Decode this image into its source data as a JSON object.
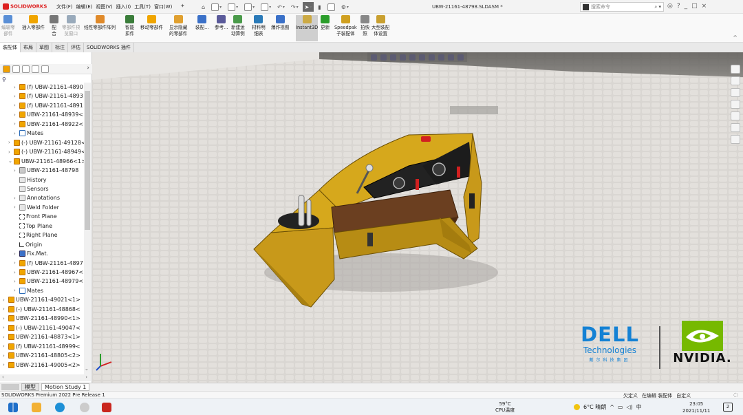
{
  "app": {
    "logo": "SOLIDWORKS",
    "menus": [
      "文件(F)",
      "编辑(E)",
      "视图(V)",
      "插入(I)",
      "工具(T)",
      "窗口(W)"
    ],
    "filename": "UBW-21161-48798.SLDASM *",
    "search_placeholder": "搜索命令",
    "window_controls": [
      "?",
      "_",
      "□",
      "×"
    ]
  },
  "ribbon": {
    "commands": [
      {
        "l1": "编辑零",
        "l2": "部件",
        "dim": true
      },
      {
        "l1": "插入零部件",
        "l2": "",
        "dim": false
      },
      {
        "l1": "配",
        "l2": "合",
        "dim": false
      },
      {
        "l1": "零部件预",
        "l2": "览窗口",
        "dim": true
      },
      {
        "l1": "线性零部件阵列",
        "l2": "",
        "dim": false
      },
      {
        "l1": "智能",
        "l2": "扣件",
        "dim": false
      },
      {
        "l1": "移动零部件",
        "l2": "",
        "dim": false
      },
      {
        "l1": "显示隐藏",
        "l2": "的零部件",
        "dim": false
      },
      {
        "l1": "装配...",
        "l2": "",
        "dim": false
      },
      {
        "l1": "参考...",
        "l2": "",
        "dim": false
      },
      {
        "l1": "新建运",
        "l2": "动算例",
        "dim": false
      },
      {
        "l1": "材料明",
        "l2": "细表",
        "dim": false
      },
      {
        "l1": "爆炸视图",
        "l2": "",
        "dim": false
      },
      {
        "l1": "Instant3D",
        "l2": "",
        "dim": false
      },
      {
        "l1": "更新",
        "l2": "",
        "dim": false
      },
      {
        "l1": "Speedpak",
        "l2": "子装配体",
        "dim": false
      },
      {
        "l1": "拍快",
        "l2": "照",
        "dim": false
      },
      {
        "l1": "大型装配",
        "l2": "体设置",
        "dim": false
      }
    ]
  },
  "tabs": [
    "装配体",
    "布局",
    "草图",
    "标注",
    "评估",
    "SOLIDWORKS 插件"
  ],
  "tree": [
    {
      "label": "(f) UBW-21161-4890",
      "icon": "part",
      "indent": 2,
      "ex": "›"
    },
    {
      "label": "(f) UBW-21161-4893",
      "icon": "part",
      "indent": 2,
      "ex": "›"
    },
    {
      "label": "(f) UBW-21161-4891",
      "icon": "part",
      "indent": 2,
      "ex": "›"
    },
    {
      "label": "UBW-21161-48939<",
      "icon": "part",
      "indent": 2,
      "ex": "›"
    },
    {
      "label": "UBW-21161-48922<",
      "icon": "part",
      "indent": 2,
      "ex": "›"
    },
    {
      "label": "Mates",
      "icon": "mates",
      "indent": 2,
      "ex": "›"
    },
    {
      "label": "(-) UBW-21161-49128<",
      "icon": "part",
      "indent": 1,
      "ex": "›"
    },
    {
      "label": "(-) UBW-21161-48949<",
      "icon": "part",
      "indent": 1,
      "ex": "›"
    },
    {
      "label": "UBW-21161-48966<1>",
      "icon": "part",
      "indent": 1,
      "ex": "⌄"
    },
    {
      "label": "UBW-21161-48798",
      "icon": "asm",
      "indent": 2,
      "ex": "›"
    },
    {
      "label": "History",
      "icon": "folder",
      "indent": 2,
      "ex": ""
    },
    {
      "label": "Sensors",
      "icon": "folder",
      "indent": 2,
      "ex": ""
    },
    {
      "label": "Annotations",
      "icon": "folder",
      "indent": 2,
      "ex": "›"
    },
    {
      "label": "Weld Folder",
      "icon": "folder",
      "indent": 2,
      "ex": "›"
    },
    {
      "label": "Front Plane",
      "icon": "plane",
      "indent": 2,
      "ex": ""
    },
    {
      "label": "Top Plane",
      "icon": "plane",
      "indent": 2,
      "ex": ""
    },
    {
      "label": "Right Plane",
      "icon": "plane",
      "indent": 2,
      "ex": ""
    },
    {
      "label": "Origin",
      "icon": "origin",
      "indent": 2,
      "ex": ""
    },
    {
      "label": "Fix.Mat.",
      "icon": "fix",
      "indent": 2,
      "ex": "›"
    },
    {
      "label": "(f) UBW-21161-4897",
      "icon": "part",
      "indent": 2,
      "ex": "›"
    },
    {
      "label": "UBW-21161-48967<",
      "icon": "part",
      "indent": 2,
      "ex": "›"
    },
    {
      "label": "UBW-21161-48979<",
      "icon": "part",
      "indent": 2,
      "ex": "›"
    },
    {
      "label": "Mates",
      "icon": "mates",
      "indent": 2,
      "ex": "›"
    },
    {
      "label": "UBW-21161-49021<1>",
      "icon": "part",
      "indent": 0,
      "ex": "›"
    },
    {
      "label": "(-) UBW-21161-48868<",
      "icon": "part",
      "indent": 0,
      "ex": "›"
    },
    {
      "label": "UBW-21161-48990<1>",
      "icon": "part",
      "indent": 0,
      "ex": "›"
    },
    {
      "label": "(-) UBW-21161-49047<",
      "icon": "part",
      "indent": 0,
      "ex": "›"
    },
    {
      "label": "UBW-21161-48873<1>",
      "icon": "part",
      "indent": 0,
      "ex": "›"
    },
    {
      "label": "(f) UBW-21161-48999<",
      "icon": "part",
      "indent": 0,
      "ex": "›"
    },
    {
      "label": "UBW-21161-48805<2>",
      "icon": "part",
      "indent": 0,
      "ex": "›"
    },
    {
      "label": "UBW-21161-49005<2>",
      "icon": "part",
      "indent": 0,
      "ex": "›"
    }
  ],
  "model_tabs": [
    "模型",
    "Motion Study 1"
  ],
  "status": {
    "left": "SOLIDWORKS Premium 2022 Pre Release 1",
    "right": [
      "欠定义",
      "在编辑 装配体",
      "自定义"
    ]
  },
  "logos": {
    "dell_big": "DELL",
    "dell_tech": "Technologies",
    "dell_cn": "戴尔科技集团",
    "nvidia": "NVIDIA."
  },
  "taskbar": {
    "cpu_temp": "59°C",
    "cpu_label": "CPU温度",
    "weather": "6°C 晴朗",
    "tray": [
      "^",
      "中"
    ],
    "time": "23:05",
    "date": "2021/11/11",
    "notif": "2"
  },
  "colors": {
    "model_yellow": "#d6a81c",
    "accent_red": "#d22020",
    "dell_blue": "#1481d4",
    "nvidia_green": "#76b900"
  }
}
